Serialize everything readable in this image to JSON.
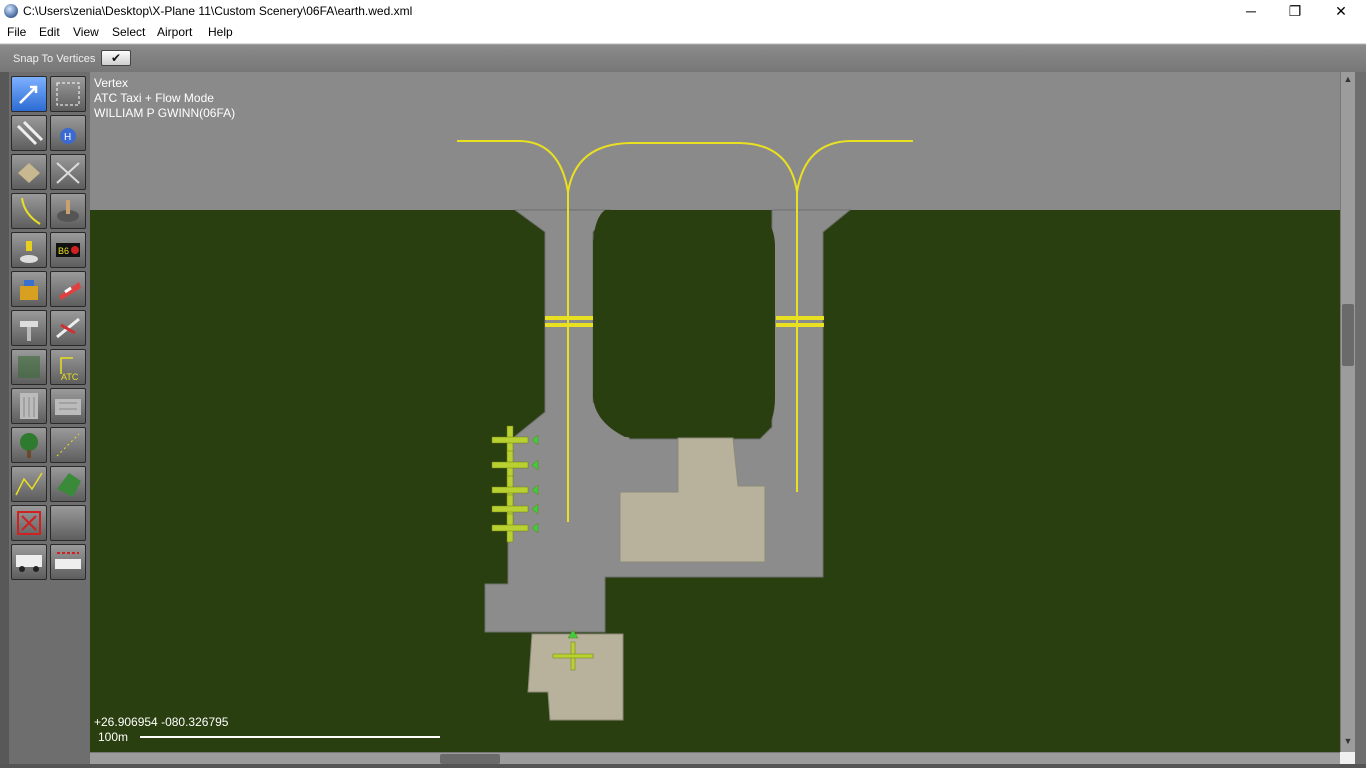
{
  "window": {
    "title": "C:\\Users\\zenia\\Desktop\\X-Plane 11\\Custom Scenery\\06FA\\earth.wed.xml",
    "minimize_glyph": "─",
    "maximize_glyph": "❐",
    "close_glyph": "✕"
  },
  "menu": [
    "File",
    "Edit",
    "View",
    "Select",
    "Airport",
    "Help"
  ],
  "toolbar": {
    "snap_label": "Snap To Vertices",
    "snap_checked_glyph": "✔"
  },
  "tools": [
    {
      "name": "vertex-tool-icon",
      "active": true
    },
    {
      "name": "marquee-tool-icon"
    },
    {
      "name": "runway-tool-icon"
    },
    {
      "name": "helipad-tool-icon"
    },
    {
      "name": "taxiway-tool-icon"
    },
    {
      "name": "hole-tool-icon"
    },
    {
      "name": "taxiline-tool-icon"
    },
    {
      "name": "boundary-tool-icon"
    },
    {
      "name": "light-tool-icon"
    },
    {
      "name": "sign-tool-icon"
    },
    {
      "name": "tower-tool-icon"
    },
    {
      "name": "windsock-tool-icon"
    },
    {
      "name": "beacon-tool-icon"
    },
    {
      "name": "ramp-start-tool-icon"
    },
    {
      "name": "atc-taxi-tool-icon"
    },
    {
      "name": "atc-flow-tool-icon"
    },
    {
      "name": "facade-tool-icon"
    },
    {
      "name": "facade-2-tool-icon"
    },
    {
      "name": "forest-tool-icon"
    },
    {
      "name": "object-string-tool-icon"
    },
    {
      "name": "line-tool-icon"
    },
    {
      "name": "polygon-tool-icon"
    },
    {
      "name": "exclusion-tool-icon"
    },
    {
      "name": "blank-tool-icon"
    },
    {
      "name": "truck-parking-tool-icon"
    },
    {
      "name": "truck-destination-tool-icon"
    }
  ],
  "map": {
    "info_lines": [
      "Vertex",
      "ATC Taxi + Flow Mode",
      "WILLIAM P GWINN(06FA)"
    ],
    "coords": "+26.906954 -080.326795",
    "scale_label": "100m"
  },
  "colors": {
    "grass": "#2a3f10",
    "pavement": "#8c8c8c",
    "taxiline": "#e8e020",
    "ramp_start": "#b8d030",
    "active_tool": "#3a7ae0"
  }
}
